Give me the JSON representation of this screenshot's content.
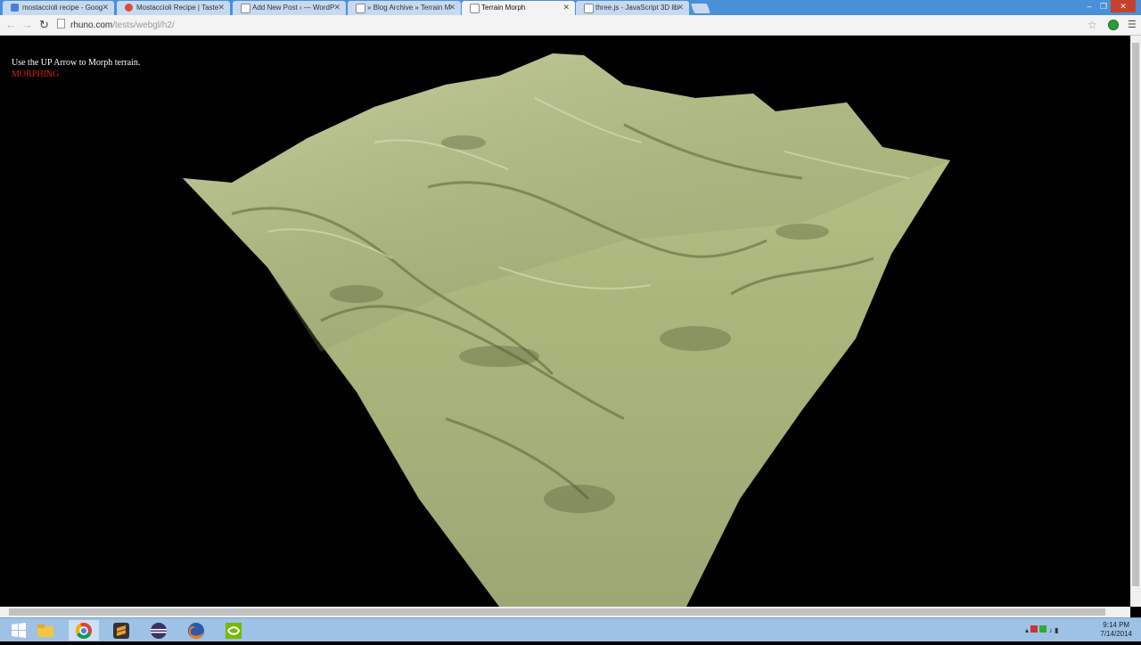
{
  "tabs": [
    {
      "title": "mostaccioli recipe - Goog",
      "color": "#4a7fd6",
      "active": false
    },
    {
      "title": "Mostaccioli Recipe | Taste",
      "color": "#e04a3a",
      "active": false
    },
    {
      "title": "Add New Post ‹ — WordP",
      "color": "#ffffff",
      "active": false
    },
    {
      "title": "» Blog Archive » Terrain M",
      "color": "#ffffff",
      "active": false
    },
    {
      "title": "Terrain Morph",
      "color": "#ffffff",
      "active": true
    },
    {
      "title": "three.js - JavaScript 3D lib",
      "color": "#ffffff",
      "active": false
    }
  ],
  "address": {
    "host": "rhuno.com",
    "path": "/tests/webgl/h2/"
  },
  "page": {
    "instruction": "Use the UP Arrow to Morph terrain.",
    "status": "MORPHING"
  },
  "colors": {
    "status": "#d42020",
    "terrain": "#a9b87a",
    "tabbar": "#4a90d8"
  },
  "icons": [
    "windows-start-icon",
    "file-explorer-icon",
    "chrome-icon",
    "sublime-text-icon",
    "eclipse-icon",
    "firefox-icon",
    "nvidia-icon"
  ],
  "tray": {
    "time": "9:14 PM",
    "date": "7/14/2014"
  }
}
